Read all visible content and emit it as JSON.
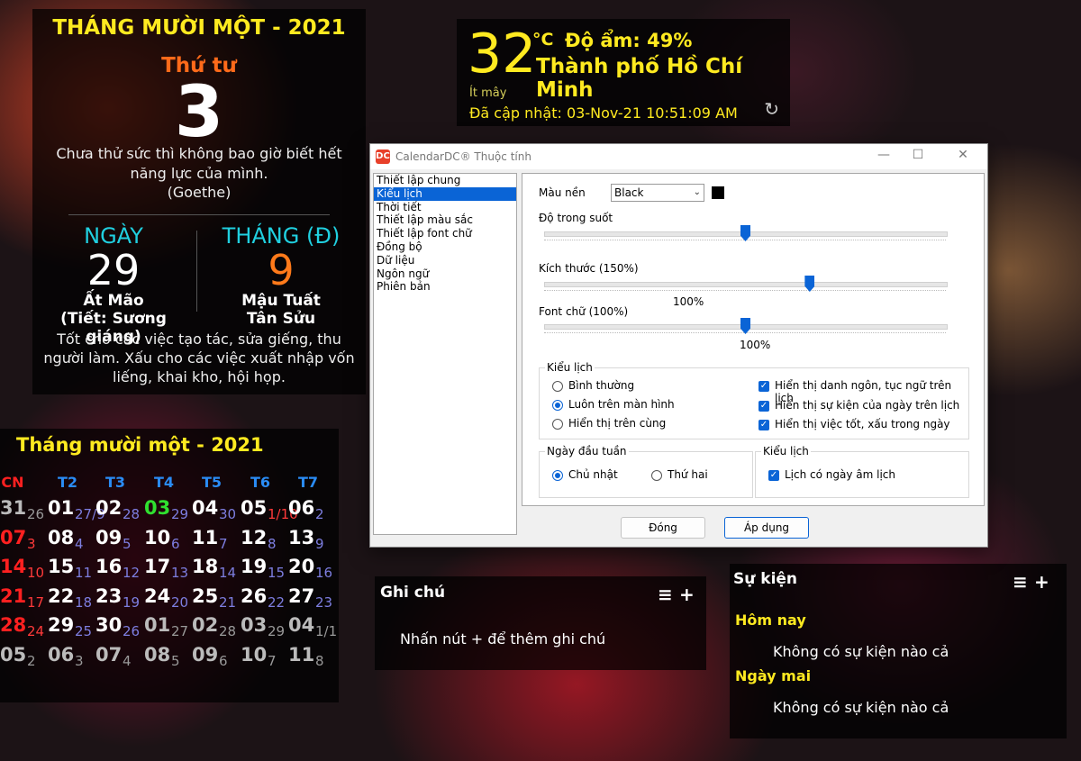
{
  "day_card": {
    "month_title": "THÁNG MƯỜI MỘT - 2021",
    "weekday": "Thứ tư",
    "day": "3",
    "quote_line1": "Chưa thử sức thì không bao giờ biết hết",
    "quote_line2": "năng lực của mình.",
    "author": "(Goethe)",
    "lunar_day_label": "NGÀY",
    "lunar_day": "29",
    "lunar_day_can_chi": "Ất Mão",
    "lunar_day_term": "(Tiết: Sương giáng)",
    "lunar_month_label": "THÁNG (Đ)",
    "lunar_month": "9",
    "lunar_month_can_chi": "Mậu Tuất",
    "lunar_year_can_chi": "Tân Sửu",
    "advice_line1": "Tốt cho các việc tạo tác, sửa giếng, thu",
    "advice_line2": "người làm. Xấu cho các việc xuất nhập vốn",
    "advice_line3": "liếng, khai kho, hội họp."
  },
  "weather": {
    "temperature": "32",
    "unit": "°C",
    "humidity": "Độ ẩm: 49%",
    "city": "Thành phố Hồ Chí Minh",
    "condition": "Ít mây",
    "updated": "Đã cập nhật: 03-Nov-21 10:51:09 AM",
    "refresh_icon": "↻"
  },
  "month_calendar": {
    "title": "Tháng mười một - 2021",
    "weekdays": [
      "CN",
      "T2",
      "T3",
      "T4",
      "T5",
      "T6",
      "T7"
    ],
    "weeks": [
      [
        [
          "31",
          "26",
          "other"
        ],
        [
          "01",
          "27/9",
          ""
        ],
        [
          "02",
          "28",
          ""
        ],
        [
          "03",
          "29",
          "today"
        ],
        [
          "04",
          "30",
          ""
        ],
        [
          "05",
          "1/10",
          "red"
        ],
        [
          "06",
          "2",
          ""
        ]
      ],
      [
        [
          "07",
          "3",
          ""
        ],
        [
          "08",
          "4",
          ""
        ],
        [
          "09",
          "5",
          ""
        ],
        [
          "10",
          "6",
          ""
        ],
        [
          "11",
          "7",
          ""
        ],
        [
          "12",
          "8",
          ""
        ],
        [
          "13",
          "9",
          ""
        ]
      ],
      [
        [
          "14",
          "10",
          ""
        ],
        [
          "15",
          "11",
          ""
        ],
        [
          "16",
          "12",
          ""
        ],
        [
          "17",
          "13",
          ""
        ],
        [
          "18",
          "14",
          ""
        ],
        [
          "19",
          "15",
          ""
        ],
        [
          "20",
          "16",
          ""
        ]
      ],
      [
        [
          "21",
          "17",
          ""
        ],
        [
          "22",
          "18",
          ""
        ],
        [
          "23",
          "19",
          ""
        ],
        [
          "24",
          "20",
          ""
        ],
        [
          "25",
          "21",
          ""
        ],
        [
          "26",
          "22",
          ""
        ],
        [
          "27",
          "23",
          ""
        ]
      ],
      [
        [
          "28",
          "24",
          ""
        ],
        [
          "29",
          "25",
          ""
        ],
        [
          "30",
          "26",
          ""
        ],
        [
          "01",
          "27",
          "other"
        ],
        [
          "02",
          "28",
          "other"
        ],
        [
          "03",
          "29",
          "other"
        ],
        [
          "04",
          "1/1",
          "other"
        ]
      ],
      [
        [
          "05",
          "2",
          "other"
        ],
        [
          "06",
          "3",
          "other"
        ],
        [
          "07",
          "4",
          "other"
        ],
        [
          "08",
          "5",
          "other"
        ],
        [
          "09",
          "6",
          "other"
        ],
        [
          "10",
          "7",
          "other"
        ],
        [
          "11",
          "8",
          "other"
        ]
      ]
    ]
  },
  "notes": {
    "title": "Ghi chú",
    "hint": "Nhấn nút + để thêm ghi chú",
    "menu_icon": "≡",
    "add_icon": "+"
  },
  "events": {
    "title": "Sự kiện",
    "today_label": "Hôm nay",
    "today_text": "Không có sự kiện nào cả",
    "tomorrow_label": "Ngày mai",
    "tomorrow_text": "Không có sự kiện nào cả",
    "menu_icon": "≡",
    "add_icon": "+"
  },
  "dialog": {
    "title": "CalendarDC® Thuộc tính",
    "app_icon": "DC",
    "minimize": "—",
    "maximize": "☐",
    "close": "✕",
    "nav": [
      "Thiết lập chung",
      "Kiểu lịch",
      "Thời tiết",
      "Thiết lập màu sắc",
      "Thiết lập font chữ",
      "Đồng bộ",
      "Dữ liệu",
      "Ngôn ngữ",
      "Phiên bản"
    ],
    "nav_selected": 1,
    "background_label": "Màu nền",
    "background_value": "Black",
    "background_color": "#000000",
    "opacity_label": "Độ trong suốt",
    "opacity_value": 0.5,
    "size_label": "Kích thước (150%)",
    "size_value": 0.66,
    "size_tick_label": "100%",
    "font_label": "Font chữ (100%)",
    "font_value": 0.5,
    "font_tick_label": "100%",
    "style_group": "Kiểu lịch",
    "radio_normal": "Bình thường",
    "radio_ontop": "Luôn trên màn hình",
    "radio_top": "Hiển thị trên cùng",
    "check_quote": "Hiển thị danh ngôn, tục ngữ trên lịch",
    "check_events": "Hiển thị sự kiện của ngày trên lịch",
    "check_goodbad": "Hiển thị việc tốt, xấu trong ngày",
    "week_start_group": "Ngày đầu tuần",
    "radio_sunday": "Chủ nhật",
    "radio_monday": "Thứ hai",
    "calendar_type_group": "Kiểu lịch",
    "check_lunar": "Lịch có ngày âm lịch",
    "close_button": "Đóng",
    "apply_button": "Áp dụng",
    "accent_color": "#0a64d6"
  }
}
